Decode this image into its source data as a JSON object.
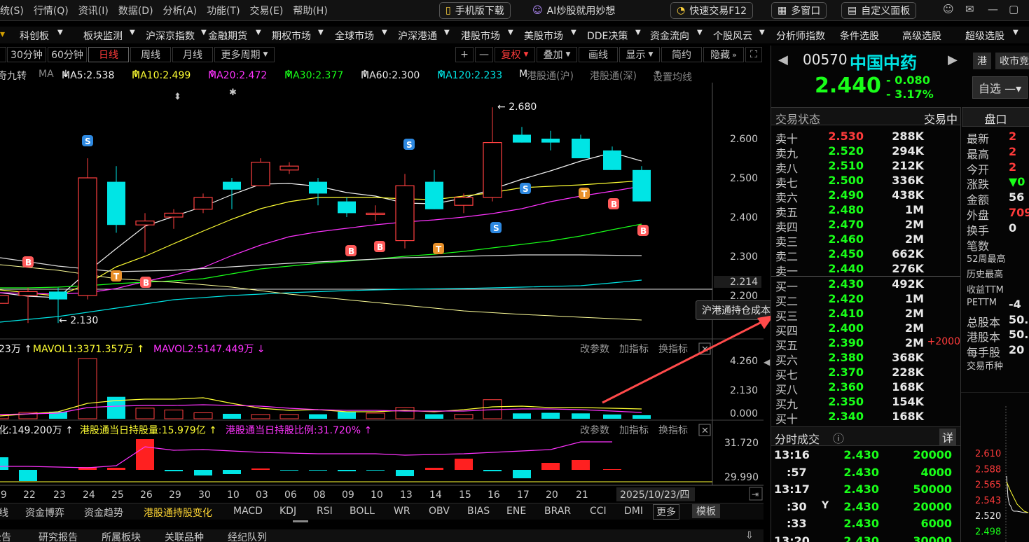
{
  "menu": [
    "统(S)",
    "行情(Q)",
    "资讯(I)",
    "数据(D)",
    "分析(A)",
    "功能(T)",
    "交易(E)",
    "帮助(H)"
  ],
  "topbuttons": {
    "mobile": "手机版下载",
    "ai": "AI炒股就用妙想",
    "fast_trade": "快速交易F12",
    "multi_window": "多窗口",
    "custom_panel": "自定义面板"
  },
  "nav": [
    "科创板",
    "板块监测",
    "沪深京指数",
    "金融期货",
    "期权市场",
    "全球市场",
    "沪深港通",
    "港股市场",
    "美股市场",
    "DDE决策",
    "资金流向",
    "个股风云",
    "分析师指数",
    "条件选股",
    "高级选股",
    "超级选股"
  ],
  "periods": {
    "m30": "30分钟",
    "m60": "60分钟",
    "day": "日线",
    "week": "周线",
    "month": "月线",
    "more": "更多周期",
    "restore": "复权",
    "overlay": "叠加",
    "draw": "画线",
    "show": "显示",
    "simple": "简约",
    "hide": "隐藏"
  },
  "ma": {
    "prefix": "奇九转",
    "ma_label": "MA",
    "ma5": "MA5:2.538",
    "ma10": "MA10:2.499",
    "ma20": "MA20:2.472",
    "ma30": "MA30:2.377",
    "ma60": "MA60:2.300",
    "ma120": "MA120:2.233",
    "m": "M",
    "hk_sh": "港股通(沪)",
    "hk_sz": "港股通(深)",
    "set_ma": "设置均线"
  },
  "vol_legend": {
    "v0": "23万",
    "mavol1": "MAVOL1:3371.357万",
    "mavol2": "MAVOL2:5147.449万",
    "params": "改参数",
    "add_ind": "加指标",
    "swap_ind": "换指标"
  },
  "hk_legend": {
    "h0": "化:149.200万",
    "h1": "港股通当日持股量:15.979亿",
    "h2": "港股通当日持股比例:31.720%",
    "params": "改参数",
    "add_ind": "加指标",
    "swap_ind": "换指标"
  },
  "price_axis": {
    "p1": "2.600",
    "p2": "2.500",
    "p3": "2.400",
    "p4": "2.300",
    "p5": "2.214",
    "p6": "2.200"
  },
  "vol_axis": {
    "v1": "4.260",
    "v2": "2.130",
    "v3": "0.000"
  },
  "hk_axis": {
    "h1": "31.720",
    "h2": "29.990"
  },
  "dates": [
    "19",
    "22",
    "23",
    "24",
    "25",
    "26",
    "29",
    "30",
    "10",
    "03",
    "06",
    "08",
    "09",
    "10",
    "13",
    "14",
    "15",
    "16",
    "17",
    "20",
    "21"
  ],
  "current_date": "2025/10/23/四",
  "annotations": {
    "high": "2.680",
    "low": "2.130",
    "tooltip": "沪港通持仓成本: 2.211"
  },
  "signals": {
    "s": "S",
    "b": "B",
    "t": "T"
  },
  "bottom_tabs": [
    "线",
    "资金博弈",
    "资金趋势",
    "港股通持股变化",
    "MACD",
    "KDJ",
    "RSI",
    "BOLL",
    "WR",
    "OBV",
    "BIAS",
    "ENE",
    "BRAR",
    "CCI",
    "DMI",
    "更多",
    "模板"
  ],
  "bottom_tabs2": [
    "公告",
    "研究报告",
    "所属板块",
    "关联品种",
    "经纪队列"
  ],
  "stock": {
    "code": "00570",
    "name": "中国中药",
    "market": "港",
    "price": "2.440",
    "change": "- 0.080",
    "pct": "- 3.17%",
    "watch": "自选",
    "compete": "收市竞"
  },
  "trade_status": {
    "label": "交易状态",
    "value": "交易中",
    "panel": "盘口"
  },
  "asks": [
    {
      "label": "卖十",
      "price": "2.530",
      "vol": "288K"
    },
    {
      "label": "卖九",
      "price": "2.520",
      "vol": "294K"
    },
    {
      "label": "卖八",
      "price": "2.510",
      "vol": "212K"
    },
    {
      "label": "卖七",
      "price": "2.500",
      "vol": "336K"
    },
    {
      "label": "卖六",
      "price": "2.490",
      "vol": "438K"
    },
    {
      "label": "卖五",
      "price": "2.480",
      "vol": "1M"
    },
    {
      "label": "卖四",
      "price": "2.470",
      "vol": "2M"
    },
    {
      "label": "卖三",
      "price": "2.460",
      "vol": "2M"
    },
    {
      "label": "卖二",
      "price": "2.450",
      "vol": "662K"
    },
    {
      "label": "卖一",
      "price": "2.440",
      "vol": "276K"
    }
  ],
  "bids": [
    {
      "label": "买一",
      "price": "2.430",
      "vol": "492K",
      "chg": ""
    },
    {
      "label": "买二",
      "price": "2.420",
      "vol": "1M",
      "chg": ""
    },
    {
      "label": "买三",
      "price": "2.410",
      "vol": "2M",
      "chg": ""
    },
    {
      "label": "买四",
      "price": "2.400",
      "vol": "2M",
      "chg": ""
    },
    {
      "label": "买五",
      "price": "2.390",
      "vol": "2M",
      "chg": "+2000"
    },
    {
      "label": "买六",
      "price": "2.380",
      "vol": "368K",
      "chg": ""
    },
    {
      "label": "买七",
      "price": "2.370",
      "vol": "228K",
      "chg": ""
    },
    {
      "label": "买八",
      "price": "2.360",
      "vol": "168K",
      "chg": ""
    },
    {
      "label": "买九",
      "price": "2.350",
      "vol": "154K",
      "chg": ""
    },
    {
      "label": "买十",
      "price": "2.340",
      "vol": "168K",
      "chg": ""
    }
  ],
  "ticks_header": {
    "label": "分时成交",
    "detail": "详"
  },
  "ticks": [
    {
      "time": "13:16",
      "flag": "",
      "price": "2.430",
      "vol": "20000"
    },
    {
      "time": ":57",
      "flag": "",
      "price": "2.430",
      "vol": "4000"
    },
    {
      "time": "13:17",
      "flag": "",
      "price": "2.430",
      "vol": "50000"
    },
    {
      "time": ":30",
      "flag": "Y",
      "price": "2.430",
      "vol": "20000"
    },
    {
      "time": ":33",
      "flag": "",
      "price": "2.430",
      "vol": "6000"
    },
    {
      "time": "13:20",
      "flag": "",
      "price": "2.430",
      "vol": "30000"
    }
  ],
  "pankou": [
    {
      "label": "最新",
      "value": "2"
    },
    {
      "label": "最高",
      "value": "2"
    },
    {
      "label": "今开",
      "value": "2"
    },
    {
      "label": "涨跌",
      "value": "▼0"
    },
    {
      "label": "金额",
      "value": "56"
    },
    {
      "label": "外盘",
      "value": "709."
    },
    {
      "label": "换手",
      "value": "0"
    },
    {
      "label": "笔数",
      "value": ""
    },
    {
      "label": "52周最高",
      "value": ""
    },
    {
      "label": "历史最高",
      "value": ""
    },
    {
      "label": "收益TTM",
      "value": ""
    },
    {
      "label": "PETTM",
      "value": "-4"
    },
    {
      "label": "总股本",
      "value": "50."
    },
    {
      "label": "港股本",
      "value": "50."
    },
    {
      "label": "每手股",
      "value": "20"
    },
    {
      "label": "交易币种",
      "value": ""
    }
  ],
  "mini_axis": [
    "2.610",
    "2.588",
    "2.565",
    "2.543",
    "2.520",
    "2.498",
    "2.475",
    "2.453"
  ],
  "chart_data": {
    "type": "candlestick",
    "title": "",
    "ylim": [
      2.13,
      2.68
    ],
    "candles": [
      {
        "d": "19",
        "o": 2.18,
        "h": 2.21,
        "l": 2.14,
        "c": 2.2
      },
      {
        "d": "22",
        "o": 2.2,
        "h": 2.22,
        "l": 2.13,
        "c": 2.21
      },
      {
        "d": "23",
        "o": 2.21,
        "h": 2.22,
        "l": 2.13,
        "c": 2.19
      },
      {
        "d": "24",
        "o": 2.2,
        "h": 2.55,
        "l": 2.19,
        "c": 2.5
      },
      {
        "d": "25",
        "o": 2.49,
        "h": 2.53,
        "l": 2.36,
        "c": 2.38
      },
      {
        "d": "26",
        "o": 2.38,
        "h": 2.41,
        "l": 2.31,
        "c": 2.39
      },
      {
        "d": "29",
        "o": 2.4,
        "h": 2.42,
        "l": 2.37,
        "c": 2.41
      },
      {
        "d": "30",
        "o": 2.42,
        "h": 2.46,
        "l": 2.41,
        "c": 2.45
      },
      {
        "d": "10",
        "o": 2.49,
        "h": 2.5,
        "l": 2.42,
        "c": 2.47
      },
      {
        "d": "03",
        "o": 2.48,
        "h": 2.55,
        "l": 2.48,
        "c": 2.54
      },
      {
        "d": "06",
        "o": 2.52,
        "h": 2.54,
        "l": 2.51,
        "c": 2.53
      },
      {
        "d": "08",
        "o": 2.49,
        "h": 2.5,
        "l": 2.43,
        "c": 2.46
      },
      {
        "d": "09",
        "o": 2.44,
        "h": 2.45,
        "l": 2.4,
        "c": 2.41
      },
      {
        "d": "10",
        "o": 2.41,
        "h": 2.43,
        "l": 2.39,
        "c": 2.41
      },
      {
        "d": "13",
        "o": 2.34,
        "h": 2.51,
        "l": 2.32,
        "c": 2.48
      },
      {
        "d": "14",
        "o": 2.49,
        "h": 2.52,
        "l": 2.42,
        "c": 2.42
      },
      {
        "d": "15",
        "o": 2.43,
        "h": 2.46,
        "l": 2.41,
        "c": 2.45
      },
      {
        "d": "16",
        "o": 2.45,
        "h": 2.68,
        "l": 2.44,
        "c": 2.59
      },
      {
        "d": "17",
        "o": 2.61,
        "h": 2.63,
        "l": 2.59,
        "c": 2.59
      },
      {
        "d": "20",
        "o": 2.6,
        "h": 2.62,
        "l": 2.57,
        "c": 2.59
      },
      {
        "d": "21",
        "o": 2.6,
        "h": 2.61,
        "l": 2.55,
        "c": 2.55
      },
      {
        "d": "22",
        "o": 2.57,
        "h": 2.58,
        "l": 2.52,
        "c": 2.52
      },
      {
        "d": "23",
        "o": 2.52,
        "h": 2.53,
        "l": 2.44,
        "c": 2.44
      }
    ]
  }
}
